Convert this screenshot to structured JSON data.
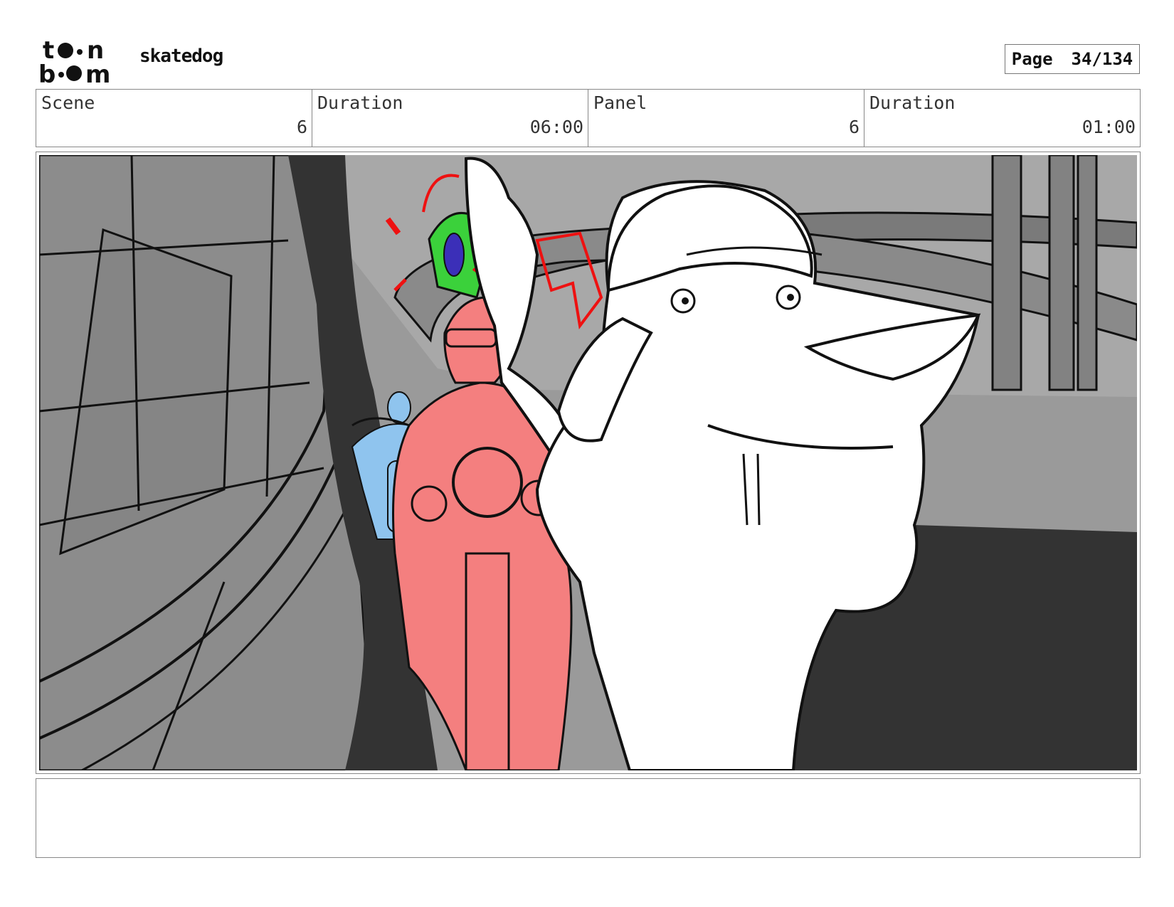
{
  "header": {
    "logo_text": "toon boom",
    "project_name": "skatedog",
    "page_label": "Page",
    "page_value": "34/134"
  },
  "info": {
    "scene_label": "Scene",
    "scene_value": "6",
    "scene_duration_label": "Duration",
    "scene_duration_value": "06:00",
    "panel_label": "Panel",
    "panel_value": "6",
    "panel_duration_label": "Duration",
    "panel_duration_value": "01:00"
  },
  "notes": {
    "text": ""
  },
  "colors": {
    "rider_front": "#f47f7f",
    "rider_back": "#8fc4ee",
    "phone": "#3bd13b",
    "highway": "#8c8c8c",
    "road": "#343434"
  }
}
